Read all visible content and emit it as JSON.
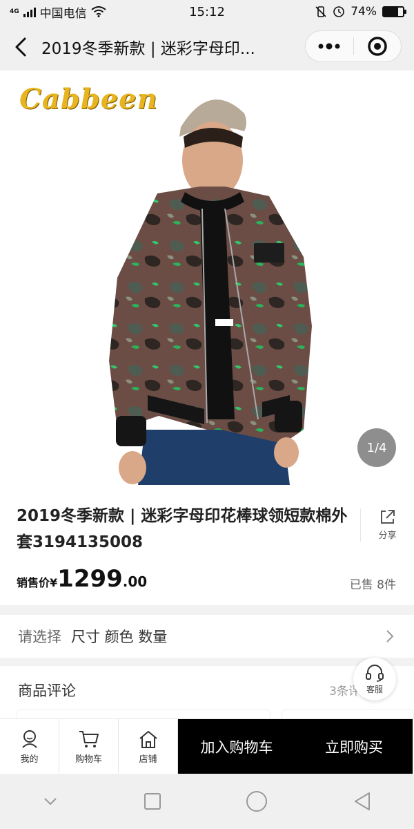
{
  "status_bar": {
    "network": "4G",
    "carrier": "中国电信",
    "time": "15:12",
    "battery_text": "74%",
    "battery_level": 0.74
  },
  "nav": {
    "title": "2019冬季新款 | 迷彩字母印...",
    "more_icon": "more-dots-icon",
    "target_icon": "target-icon"
  },
  "hero": {
    "brand_logo": "Cabbeen",
    "counter": "1/4"
  },
  "product": {
    "title": "2019冬季新款 | 迷彩字母印花棒球领短款棉外套3194135008",
    "share_label": "分享",
    "price_label": "销售价",
    "price_symbol": "¥",
    "price_int": "1299",
    "price_dec": ".00",
    "sold": "已售 8件"
  },
  "select": {
    "label": "请选择",
    "options": "尺寸 颜色 数量"
  },
  "reviews": {
    "heading": "商品评论",
    "count": "3条评"
  },
  "service": {
    "label": "客服"
  },
  "bottom_bar": {
    "tabs": [
      {
        "label": "我的",
        "icon": "profile-icon"
      },
      {
        "label": "购物车",
        "icon": "cart-icon"
      },
      {
        "label": "店铺",
        "icon": "store-icon"
      }
    ],
    "add_to_cart": "加入购物车",
    "buy_now": "立即购买"
  },
  "colors": {
    "primary_button": "#000000",
    "logo": "#e8b520"
  }
}
